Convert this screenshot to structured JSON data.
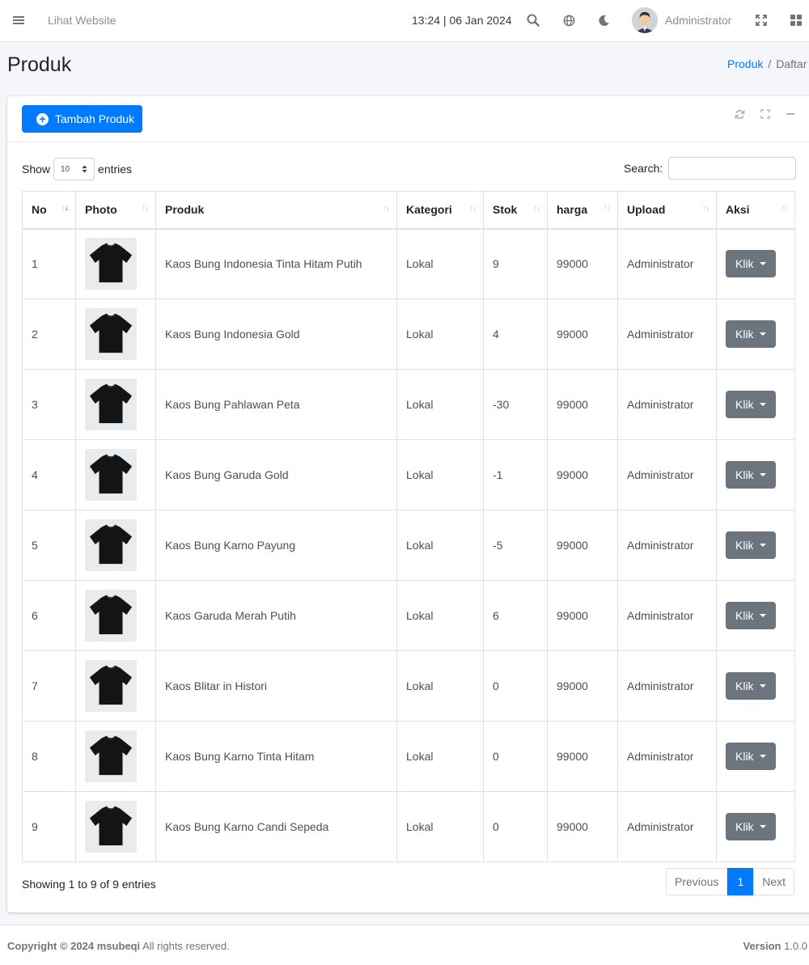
{
  "navbar": {
    "site_link": "Lihat Website",
    "clock": "13:24 | 06 Jan 2024",
    "user_name": "Administrator"
  },
  "page": {
    "title": "Produk",
    "breadcrumb": [
      "Produk",
      "Daftar"
    ],
    "breadcrumb_sep": "/"
  },
  "card": {
    "add_button": "Tambah Produk"
  },
  "datatable": {
    "show_label": "Show",
    "entries_label": "entries",
    "page_length": "10",
    "search_label": "Search:",
    "search_value": "",
    "columns": [
      "No",
      "Photo",
      "Produk",
      "Kategori",
      "Stok",
      "harga",
      "Upload",
      "Aksi"
    ],
    "rows": [
      {
        "no": "1",
        "produk": "Kaos Bung Indonesia Tinta Hitam Putih",
        "kategori": "Lokal",
        "stok": "9",
        "harga": "99000",
        "upload": "Administrator",
        "aksi": "Klik"
      },
      {
        "no": "2",
        "produk": "Kaos Bung Indonesia Gold",
        "kategori": "Lokal",
        "stok": "4",
        "harga": "99000",
        "upload": "Administrator",
        "aksi": "Klik"
      },
      {
        "no": "3",
        "produk": "Kaos Bung Pahlawan Peta",
        "kategori": "Lokal",
        "stok": "-30",
        "harga": "99000",
        "upload": "Administrator",
        "aksi": "Klik"
      },
      {
        "no": "4",
        "produk": "Kaos Bung Garuda Gold",
        "kategori": "Lokal",
        "stok": "-1",
        "harga": "99000",
        "upload": "Administrator",
        "aksi": "Klik"
      },
      {
        "no": "5",
        "produk": "Kaos Bung Karno Payung",
        "kategori": "Lokal",
        "stok": "-5",
        "harga": "99000",
        "upload": "Administrator",
        "aksi": "Klik"
      },
      {
        "no": "6",
        "produk": "Kaos Garuda Merah Putih",
        "kategori": "Lokal",
        "stok": "6",
        "harga": "99000",
        "upload": "Administrator",
        "aksi": "Klik"
      },
      {
        "no": "7",
        "produk": "Kaos Blitar in Histori",
        "kategori": "Lokal",
        "stok": "0",
        "harga": "99000",
        "upload": "Administrator",
        "aksi": "Klik"
      },
      {
        "no": "8",
        "produk": "Kaos Bung Karno Tinta Hitam",
        "kategori": "Lokal",
        "stok": "0",
        "harga": "99000",
        "upload": "Administrator",
        "aksi": "Klik"
      },
      {
        "no": "9",
        "produk": "Kaos Bung Karno Candi Sepeda",
        "kategori": "Lokal",
        "stok": "0",
        "harga": "99000",
        "upload": "Administrator",
        "aksi": "Klik"
      }
    ],
    "info": "Showing 1 to 9 of 9 entries",
    "pagination": {
      "previous": "Previous",
      "current": "1",
      "next": "Next"
    }
  },
  "footer": {
    "copyright_bold": "Copyright © 2024 msubeqi",
    "copyright_rest": "All rights reserved.",
    "version_label": "Version",
    "version_value": "1.0.0"
  },
  "colors": {
    "primary": "#007bff",
    "secondary": "#6c757d",
    "background": "#f4f6f9"
  },
  "icons": [
    "menu-icon",
    "search-icon",
    "globe-icon",
    "moon-icon",
    "fullscreen-icon",
    "apps-grid-icon",
    "refresh-icon",
    "expand-icon",
    "minimize-icon",
    "plus-circle-icon",
    "sort-icon",
    "caret-down-icon",
    "tshirt-icon"
  ]
}
